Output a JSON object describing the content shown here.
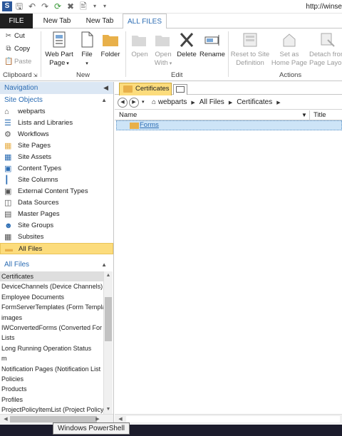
{
  "titlebar": {
    "url": "http://winse"
  },
  "tabs": {
    "file": "FILE",
    "tab1": "New Tab",
    "tab2": "New Tab",
    "active": "ALL FILES"
  },
  "ribbon": {
    "clipboard": {
      "cut": "Cut",
      "copy": "Copy",
      "paste": "Paste",
      "label": "Clipboard"
    },
    "new": {
      "web_part_page": "Web Part Page",
      "web_part_page_line1": "Web Part",
      "web_part_page_line2": "Page",
      "file": "File",
      "folder": "Folder",
      "label": "New"
    },
    "edit": {
      "open": "Open",
      "open_with_line1": "Open",
      "open_with_line2": "With",
      "delete": "Delete",
      "rename": "Rename",
      "label": "Edit"
    },
    "actions": {
      "reset_line1": "Reset to Site",
      "reset_line2": "Definition",
      "home_line1": "Set as",
      "home_line2": "Home Page",
      "detach_line1": "Detach from",
      "detach_line2": "Page Layout",
      "label": "Actions"
    }
  },
  "nav": {
    "title": "Navigation",
    "site_objects": "Site Objects",
    "items": [
      {
        "label": "webparts",
        "icon": "home-icon"
      },
      {
        "label": "Lists and Libraries",
        "icon": "list-icon"
      },
      {
        "label": "Workflows",
        "icon": "workflow-icon"
      },
      {
        "label": "Site Pages",
        "icon": "page-icon"
      },
      {
        "label": "Site Assets",
        "icon": "assets-icon"
      },
      {
        "label": "Content Types",
        "icon": "content-types-icon"
      },
      {
        "label": "Site Columns",
        "icon": "column-icon"
      },
      {
        "label": "External Content Types",
        "icon": "external-icon"
      },
      {
        "label": "Data Sources",
        "icon": "database-icon"
      },
      {
        "label": "Master Pages",
        "icon": "master-page-icon"
      },
      {
        "label": "Site Groups",
        "icon": "groups-icon"
      },
      {
        "label": "Subsites",
        "icon": "subsites-icon"
      },
      {
        "label": "All Files",
        "icon": "folder-icon"
      }
    ],
    "all_files_section": "All Files",
    "files": [
      "Certificates",
      "DeviceChannels (Device Channels)",
      "Employee Documents",
      "FormServerTemplates (Form Templa",
      "images",
      "IWConvertedForms (Converted For",
      "Lists",
      "Long Running Operation Status",
      "m",
      "Notification Pages (Notification List",
      "Policies",
      "Products",
      "Profiles",
      "ProjectPolicyItemList (Project Policy"
    ]
  },
  "main": {
    "doc_tab": "Certificates",
    "breadcrumbs": [
      "webparts",
      "All Files",
      "Certificates"
    ],
    "columns": {
      "name": "Name",
      "title": "Title"
    },
    "rows": [
      {
        "name": "Forms"
      }
    ]
  },
  "taskbar": {
    "tooltip": "Windows PowerShell"
  },
  "colors": {
    "accent": "#2b6cb3",
    "selected": "#fcdc7c",
    "nav_header": "#dbe7f4",
    "row_highlight": "#cde4f7"
  }
}
